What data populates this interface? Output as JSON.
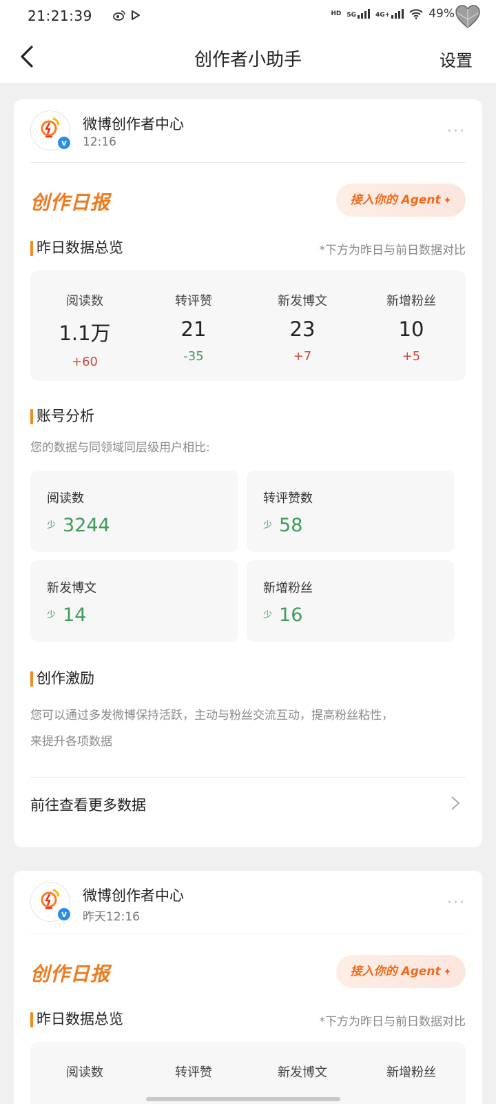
{
  "status": {
    "time": "21:21:39",
    "hd": "HD",
    "net1": "5G",
    "net2": "4G+",
    "battery": "49%"
  },
  "nav": {
    "title": "创作者小助手",
    "settings": "设置"
  },
  "cards": [
    {
      "source": "微博创作者中心",
      "time": "12:16",
      "more": "···",
      "report_title": "创作日报",
      "agent_label": "接入你的 Agent",
      "overview_title": "昨日数据总览",
      "overview_note": "*下方为昨日与前日数据对比",
      "overview": [
        {
          "label": "阅读数",
          "value": "1.1万",
          "delta": "+60"
        },
        {
          "label": "转评赞",
          "value": "21",
          "delta": "-35"
        },
        {
          "label": "新发博文",
          "value": "23",
          "delta": "+7"
        },
        {
          "label": "新增粉丝",
          "value": "10",
          "delta": "+5"
        }
      ],
      "analysis_title": "账号分析",
      "analysis_desc": "您的数据与同领域同层级用户相比:",
      "analysis": [
        {
          "label": "阅读数",
          "less": "少",
          "value": "3244"
        },
        {
          "label": "转评赞数",
          "less": "少",
          "value": "58"
        },
        {
          "label": "新发博文",
          "less": "少",
          "value": "14"
        },
        {
          "label": "新增粉丝",
          "less": "少",
          "value": "16"
        }
      ],
      "incentive_title": "创作激励",
      "incentive_desc_1": "您可以通过多发微博保持活跃，主动与粉丝交流互动，提高粉丝粘性，",
      "incentive_desc_2": "来提升各项数据",
      "link_label": "前往查看更多数据"
    },
    {
      "source": "微博创作者中心",
      "time": "昨天12:16",
      "more": "···",
      "report_title": "创作日报",
      "agent_label": "接入你的 Agent",
      "overview_title": "昨日数据总览",
      "overview_note": "*下方为昨日与前日数据对比",
      "overview": [
        {
          "label": "阅读数"
        },
        {
          "label": "转评赞"
        },
        {
          "label": "新发博文"
        },
        {
          "label": "新增粉丝"
        }
      ]
    }
  ],
  "colors": {
    "accent_orange": "#f07a1e",
    "increase_red": "#cc4b3c",
    "decrease_green": "#3e9b5a",
    "verified_blue": "#2b8ee6"
  }
}
